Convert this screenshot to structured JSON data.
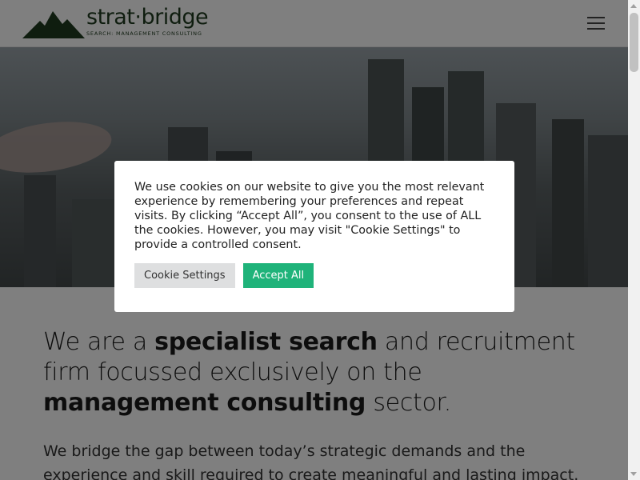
{
  "header": {
    "logo_word": "strat·bridge",
    "logo_tagline": "SEARCH: MANAGEMENT CONSULTING",
    "menu_icon": "hamburger-menu-icon"
  },
  "main": {
    "lead_part1": "We are a ",
    "lead_bold1": "specialist search",
    "lead_part2": " and recruitment firm focussed exclusively on the ",
    "lead_bold2": "management consulting",
    "lead_part3": " sector.",
    "subtext": "We bridge the gap between today’s strategic demands and the experience and skill required to create meaningful and lasting impact."
  },
  "cookie_banner": {
    "message": "We use cookies on our website to give you the most relevant experience by remembering your preferences and repeat visits. By clicking “Accept All”, you consent to the use of ALL the cookies. However, you may visit \"Cookie Settings\" to provide a controlled consent.",
    "settings_label": "Cookie Settings",
    "accept_label": "Accept All"
  },
  "colors": {
    "brand_green": "#1f3a1f",
    "accept_green": "#1fb37a",
    "settings_gray": "#dedfe0"
  }
}
